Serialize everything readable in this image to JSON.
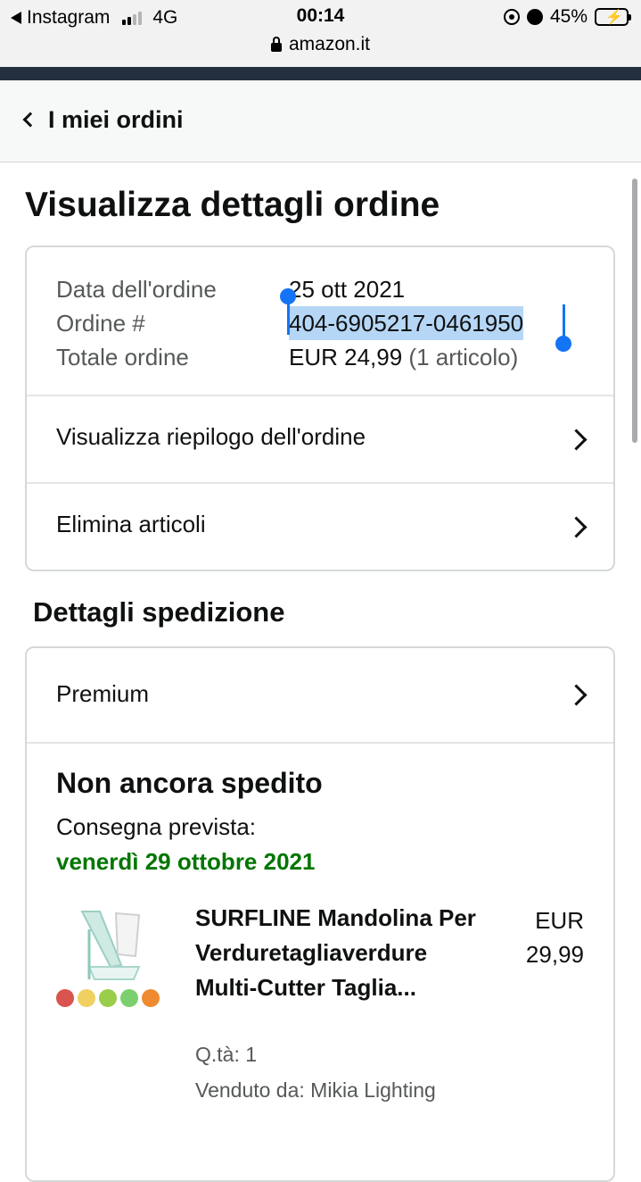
{
  "status_bar": {
    "back_app": "Instagram",
    "network": "4G",
    "time": "00:14",
    "url": "amazon.it",
    "battery": "45%"
  },
  "header": {
    "back_label": "I miei ordini"
  },
  "page_title": "Visualizza dettagli ordine",
  "order_info": {
    "date_label": "Data dell'ordine",
    "date_value": "25 ott 2021",
    "number_label": "Ordine #",
    "number_value": "404-6905217-0461950",
    "total_label": "Totale ordine",
    "total_value": "EUR 24,99",
    "total_items": "(1 articolo)"
  },
  "order_links": [
    {
      "label": "Visualizza riepilogo dell'ordine"
    },
    {
      "label": "Elimina articoli"
    }
  ],
  "shipping": {
    "section_title": "Dettagli spedizione",
    "method": "Premium",
    "status": "Non ancora spedito",
    "delivery_label": "Consegna prevista:",
    "delivery_date": "venerdì 29 ottobre 2021",
    "item": {
      "name": "SURFLINE Mandolina Per Verduretagliaverdure Multi-Cutter Taglia...",
      "price": "EUR 29,99",
      "quantity": "Q.tà: 1",
      "seller": "Venduto da: Mikia Lighting"
    }
  },
  "colors": {
    "brand_bar": "#232f3e",
    "delivery_green": "#007600",
    "selection_blue": "#1374f5",
    "selection_highlight": "#b6d6f6"
  }
}
